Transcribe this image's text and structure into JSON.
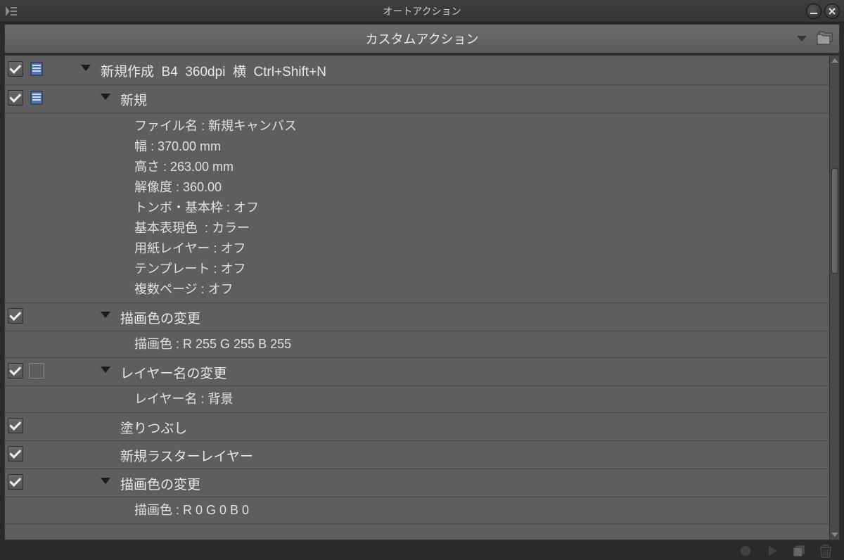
{
  "titlebar": {
    "title": "オートアクション"
  },
  "panel": {
    "title": "カスタムアクション"
  },
  "action_set": {
    "title": "新規作成  B4  360dpi  横  Ctrl+Shift+N"
  },
  "steps": [
    {
      "title": "新規",
      "has_icon": true,
      "checked": true,
      "expandable": true,
      "details": [
        "ファイル名 : 新規キャンバス",
        "幅 : 370.00 mm",
        "高さ : 263.00 mm",
        "解像度 : 360.00",
        "トンボ・基本枠 : オフ",
        "基本表現色  : カラー",
        "用紙レイヤー : オフ",
        "テンプレート : オフ",
        "複数ページ : オフ"
      ]
    },
    {
      "title": "描画色の変更",
      "has_icon": false,
      "checked": true,
      "expandable": true,
      "details": [
        "描画色 : R 255 G 255 B 255"
      ]
    },
    {
      "title": "レイヤー名の変更",
      "has_icon": false,
      "icon_outline": true,
      "checked": true,
      "expandable": true,
      "details": [
        "レイヤー名 : 背景"
      ]
    },
    {
      "title": "塗りつぶし",
      "has_icon": false,
      "checked": true,
      "expandable": false,
      "details": []
    },
    {
      "title": "新規ラスターレイヤー",
      "has_icon": false,
      "checked": true,
      "expandable": false,
      "details": []
    },
    {
      "title": "描画色の変更",
      "has_icon": false,
      "checked": true,
      "expandable": true,
      "details": [
        "描画色 : R 0 G 0 B 0"
      ]
    }
  ]
}
